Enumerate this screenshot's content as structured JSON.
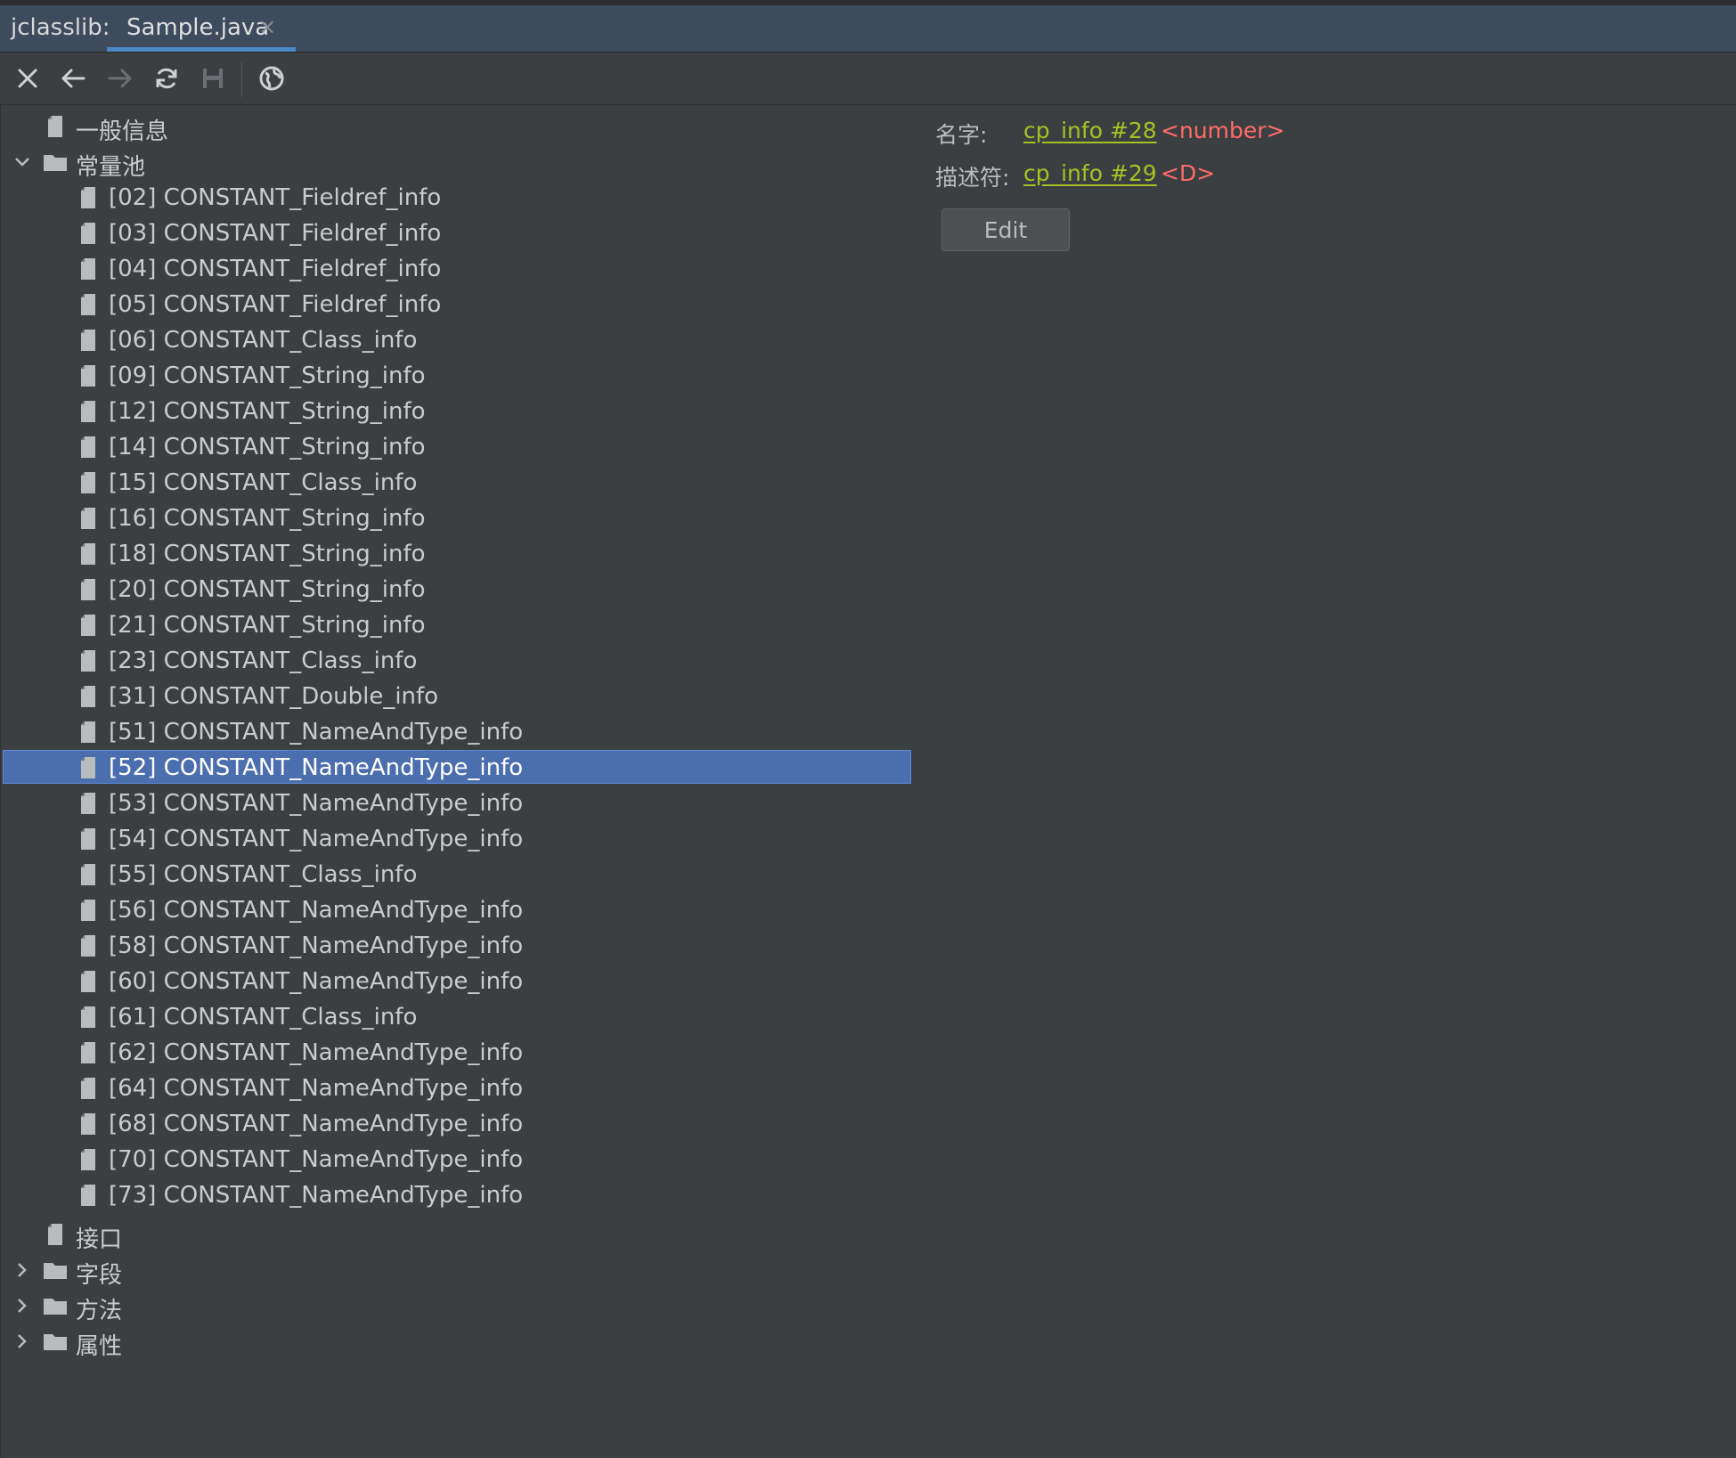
{
  "header": {
    "tool_label": "jclasslib:",
    "tab_title": "Sample.java",
    "tab_close": "×"
  },
  "toolbar": {
    "buttons": [
      "close-icon",
      "back-arrow-icon",
      "forward-arrow-icon",
      "refresh-icon",
      "save-icon",
      "web-icon"
    ]
  },
  "tree": {
    "general_info": "一般信息",
    "constant_pool": "常量池",
    "entries": [
      "[02] CONSTANT_Fieldref_info",
      "[03] CONSTANT_Fieldref_info",
      "[04] CONSTANT_Fieldref_info",
      "[05] CONSTANT_Fieldref_info",
      "[06] CONSTANT_Class_info",
      "[09] CONSTANT_String_info",
      "[12] CONSTANT_String_info",
      "[14] CONSTANT_String_info",
      "[15] CONSTANT_Class_info",
      "[16] CONSTANT_String_info",
      "[18] CONSTANT_String_info",
      "[20] CONSTANT_String_info",
      "[21] CONSTANT_String_info",
      "[23] CONSTANT_Class_info",
      "[31] CONSTANT_Double_info",
      "[51] CONSTANT_NameAndType_info",
      "[52] CONSTANT_NameAndType_info",
      "[53] CONSTANT_NameAndType_info",
      "[54] CONSTANT_NameAndType_info",
      "[55] CONSTANT_Class_info",
      "[56] CONSTANT_NameAndType_info",
      "[58] CONSTANT_NameAndType_info",
      "[60] CONSTANT_NameAndType_info",
      "[61] CONSTANT_Class_info",
      "[62] CONSTANT_NameAndType_info",
      "[64] CONSTANT_NameAndType_info",
      "[68] CONSTANT_NameAndType_info",
      "[70] CONSTANT_NameAndType_info",
      "[73] CONSTANT_NameAndType_info"
    ],
    "selected_entry": "[52] CONSTANT_NameAndType_info",
    "interfaces": "接口",
    "fields": "字段",
    "methods": "方法",
    "attributes": "属性"
  },
  "detail": {
    "name_label": "名字:",
    "name_link": "cp_info #28",
    "name_value": "<number>",
    "descriptor_label": "描述符:",
    "descriptor_link": "cp_info #29",
    "descriptor_value": "<D>",
    "edit_label": "Edit"
  },
  "colors": {
    "background": "#3c3f41",
    "tabbar": "#3d4b5c",
    "selection": "#4b6eaf",
    "link": "#a8c023",
    "value": "#ff6b68"
  }
}
